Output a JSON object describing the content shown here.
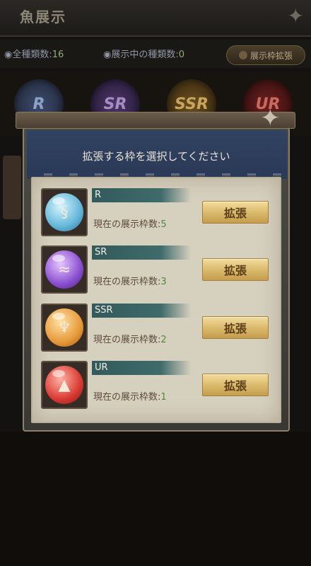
{
  "background": {
    "title": "魚展示",
    "total_species_label": "◉全種類数:",
    "total_species_value": "16",
    "shown_species_label": "◉展示中の種類数:",
    "shown_species_value": "0",
    "expand_frame_button": "展示枠拡張",
    "tabs": [
      "R",
      "SR",
      "SSR",
      "UR"
    ]
  },
  "dialog": {
    "title": "拡張する枠を選択してください",
    "count_label": "現在の展示枠数:",
    "expand_label": "拡張",
    "rows": [
      {
        "rarity": "R",
        "count": "5",
        "icon": "seahorse-icon"
      },
      {
        "rarity": "SR",
        "count": "3",
        "icon": "fish-icon"
      },
      {
        "rarity": "SSR",
        "count": "2",
        "icon": "jellyfish-icon"
      },
      {
        "rarity": "UR",
        "count": "1",
        "icon": "shark-icon"
      }
    ]
  },
  "colors": {
    "rarity_bar": "#3f6b6b",
    "count_value": "#4d8a3a",
    "button_gold": "#d9b86a"
  }
}
